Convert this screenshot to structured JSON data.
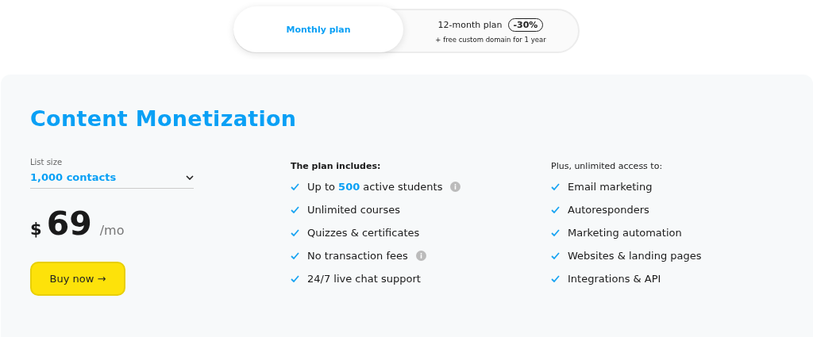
{
  "billing_toggle": [
    {
      "label": "Monthly plan",
      "selected": true
    },
    {
      "label": "12-month plan",
      "badge": "-30%",
      "subtitle": "+ free custom domain for 1 year",
      "selected": false
    }
  ],
  "plan": {
    "title": "Content Monetization",
    "list_size": {
      "label": "List size",
      "value": "1,000 contacts"
    },
    "price": {
      "currency": "$",
      "amount": "69",
      "period": "/mo"
    },
    "button": "Buy now →",
    "includes": {
      "heading": "The plan includes:",
      "items": [
        {
          "text": "Up to **500** active students",
          "info": true
        },
        {
          "text": "Unlimited courses",
          "info": false
        },
        {
          "text": "Quizzes & certificates",
          "info": false
        },
        {
          "text": "No transaction fees",
          "info": true
        },
        {
          "text": "24/7 live chat support",
          "info": false
        }
      ]
    },
    "access": {
      "heading": "Plus, unlimited access to:",
      "items": [
        {
          "text": "Email marketing",
          "info": false
        },
        {
          "text": "Autoresponders",
          "info": false
        },
        {
          "text": "Marketing automation",
          "info": false
        },
        {
          "text": "Websites & landing pages",
          "info": false
        },
        {
          "text": "Integrations & API",
          "info": false
        }
      ]
    }
  }
}
